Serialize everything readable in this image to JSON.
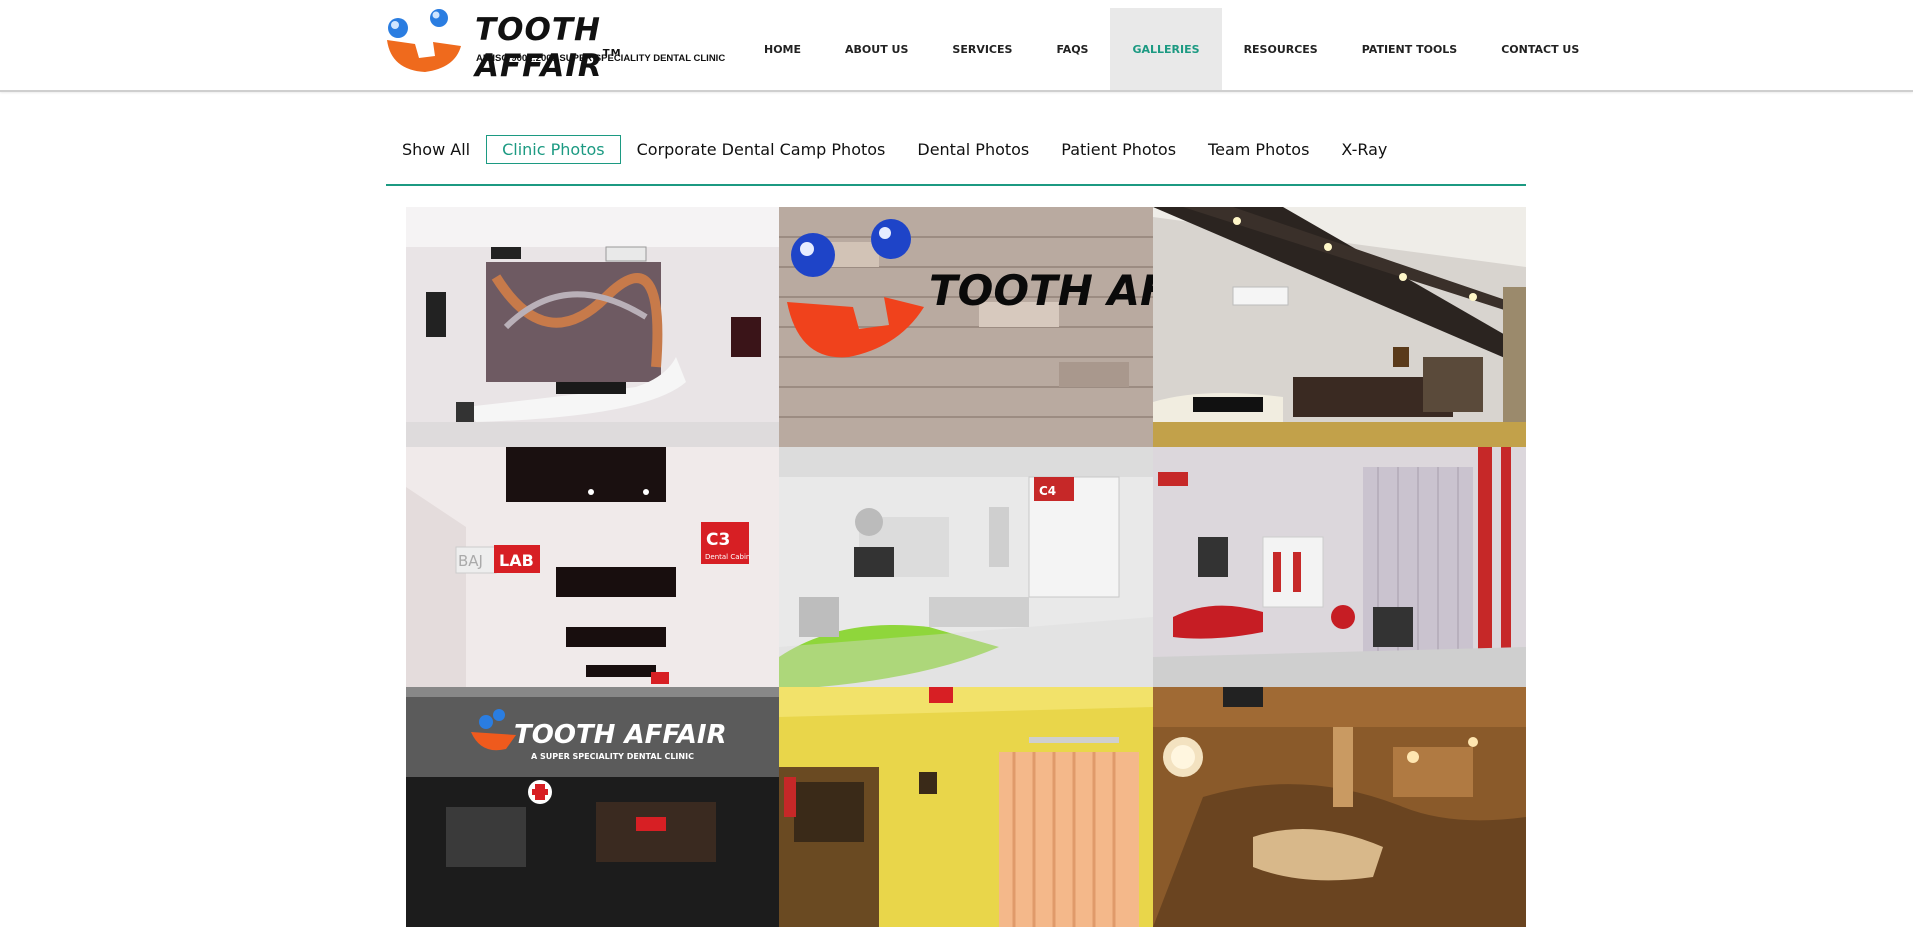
{
  "brand": {
    "name": "TOOTH AFFAIR",
    "tm": "TM",
    "tagline": "AN ISO 9001:2008 SUPER SPECIALITY DENTAL CLINIC",
    "colors": {
      "accent": "#1c9a82",
      "orange": "#ef6a1d",
      "blue": "#2a7de1"
    }
  },
  "nav": {
    "items": [
      {
        "label": "HOME"
      },
      {
        "label": "ABOUT US"
      },
      {
        "label": "SERVICES"
      },
      {
        "label": "FAQS"
      },
      {
        "label": "GALLERIES",
        "active": true
      },
      {
        "label": "RESOURCES"
      },
      {
        "label": "PATIENT TOOLS"
      },
      {
        "label": "CONTACT US"
      }
    ]
  },
  "filters": {
    "items": [
      {
        "label": "Show All"
      },
      {
        "label": "Clinic Photos",
        "active": true
      },
      {
        "label": "Corporate Dental Camp Photos"
      },
      {
        "label": "Dental Photos"
      },
      {
        "label": "Patient Photos"
      },
      {
        "label": "Team Photos"
      },
      {
        "label": "X-Ray"
      }
    ]
  },
  "gallery": {
    "tiles": [
      {
        "name": "reception-lounge"
      },
      {
        "name": "logo-stone-wall",
        "text": "TOOTH AFFAIR"
      },
      {
        "name": "office-cabin"
      },
      {
        "name": "corridor-signs",
        "labels": [
          "LAB",
          "C3",
          "Dental Cabin",
          "BAJ"
        ]
      },
      {
        "name": "dental-chair-green",
        "labels": [
          "C4"
        ]
      },
      {
        "name": "dental-chair-red"
      },
      {
        "name": "storefront",
        "text": "TOOTH AFFAIR",
        "subtext": "A SUPER SPECIALITY DENTAL CLINIC"
      },
      {
        "name": "yellow-room"
      },
      {
        "name": "operatory-amber"
      }
    ]
  }
}
